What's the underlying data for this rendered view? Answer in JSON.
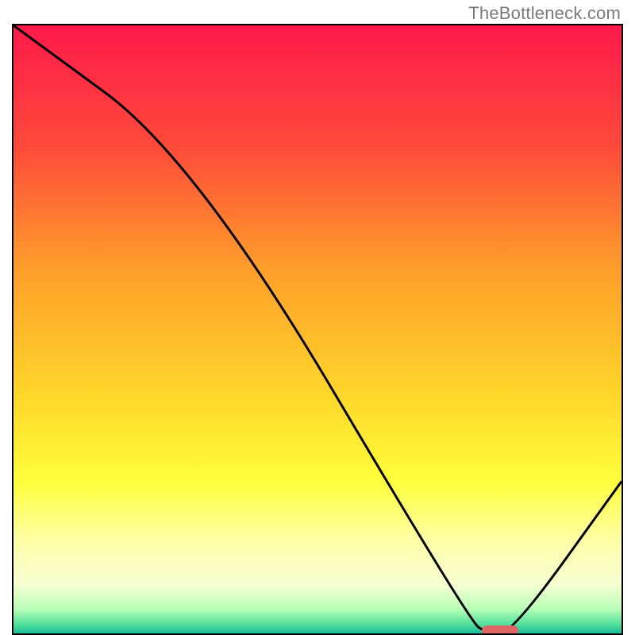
{
  "watermark": "TheBottleneck.com",
  "gradient": {
    "stops": [
      {
        "offset": 0.0,
        "color": "#ff1a4b"
      },
      {
        "offset": 0.2,
        "color": "#ff4a3a"
      },
      {
        "offset": 0.4,
        "color": "#ff9e2a"
      },
      {
        "offset": 0.6,
        "color": "#ffd42a"
      },
      {
        "offset": 0.75,
        "color": "#ffff3a"
      },
      {
        "offset": 0.85,
        "color": "#ffffaa"
      },
      {
        "offset": 0.92,
        "color": "#f6ffd2"
      },
      {
        "offset": 0.96,
        "color": "#b8ffb8"
      },
      {
        "offset": 0.985,
        "color": "#52e09a"
      },
      {
        "offset": 1.0,
        "color": "#1abc9c"
      }
    ]
  },
  "chart_data": {
    "type": "line",
    "title": "",
    "xlabel": "",
    "ylabel": "",
    "xlim": [
      0,
      100
    ],
    "ylim": [
      0,
      100
    ],
    "series": [
      {
        "name": "bottleneck-curve",
        "x": [
          0,
          30,
          75,
          78,
          82,
          100
        ],
        "y": [
          100,
          78,
          2,
          0,
          0,
          25
        ]
      }
    ],
    "marker": {
      "x_start": 77,
      "x_end": 83,
      "y": 0.5
    }
  },
  "colors": {
    "curve": "#000000",
    "marker": "#e06666",
    "frame": "#000000",
    "watermark": "#7a7a7a"
  }
}
